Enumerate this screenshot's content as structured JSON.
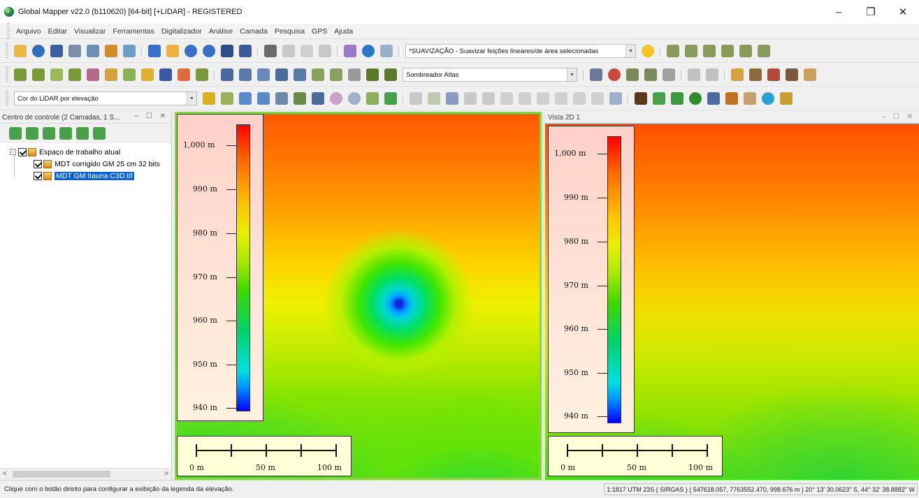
{
  "window": {
    "title": "Global Mapper v22.0 (b110620) [64-bit] [+LIDAR] - REGISTERED",
    "minimize_glyph": "–",
    "restore_glyph": "❐",
    "close_glyph": "✕"
  },
  "menu": [
    "Arquivo",
    "Editar",
    "Visualizar",
    "Ferramentas",
    "Digitalizador",
    "Análise",
    "Camada",
    "Pesquisa",
    "GPS",
    "Ajuda"
  ],
  "toolbars": {
    "smoothing_combo": "*SUAVIZAÇÃO - Suavizar feições lineares/de área selecionadas",
    "shader_combo": "Sombreador Atlas",
    "lidar_color_combo": "Cor do LiDAR por elevação",
    "colors": {
      "folder": "#e8b84a",
      "globe": "#2f6fb8",
      "save": "#3a5f9e",
      "tool": "#7a8fa8",
      "layers": "#d68a28",
      "zoom": "#3a6fc8",
      "hand": "#f0b040",
      "home": "#3b5b9b",
      "pencil": "#6a6a6a",
      "info": "#2a78c8",
      "star": "#f7c326",
      "digitizer": "#8a9a5a",
      "terrain": "#7a9a3a",
      "mountain": "#5a7a2a",
      "lidar": "#4aa04a",
      "tree": "#2e8b2e",
      "building": "#4a6aa0",
      "pole": "#c07020",
      "water": "#2aa0d8"
    }
  },
  "control_center": {
    "title": "Centro de controle (2 Camadas, 1 S...",
    "header_buttons": "– ☐ ✕",
    "tree": {
      "root_expander": "−",
      "root": "Espaço de trabalho atual",
      "layers": [
        "MDT corrigido GM 25 cm 32 bits",
        "MDT GM Itauna C3D.tif"
      ]
    },
    "scroll_left": "<",
    "scroll_right": ">"
  },
  "view_right": {
    "title": "Vista 2D 1",
    "header_buttons": "– ☐ ✕"
  },
  "legend": {
    "labels": [
      "1,000 m",
      "990 m",
      "980 m",
      "970 m",
      "960 m",
      "950 m",
      "940 m"
    ]
  },
  "scalebar": {
    "labels": [
      "0 m",
      "50 m",
      "100 m"
    ]
  },
  "status": {
    "message": "Clique com o botão direito para configurar a exibição da legenda da elevação.",
    "coords": "1:1817  UTM 23S ( SIRGAS ) ( 547618.057, 7763552.470, 998.676 m )  20° 13' 30.0623\" S, 44° 32' 38.8882\" W"
  }
}
